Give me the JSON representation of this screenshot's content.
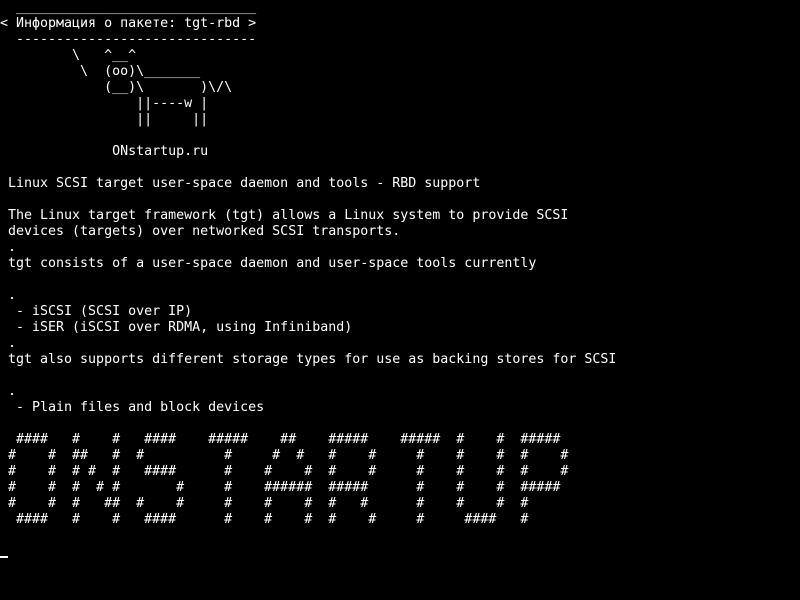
{
  "colors": {
    "background": "#000000",
    "foreground": "#ffffff"
  },
  "bubble": {
    "border_top": " ______________________________",
    "title": "< Информация о пакете: tgt-rbd >",
    "border_bottom": " ------------------------------"
  },
  "cow": [
    "        \\   ^__^",
    "         \\  (oo)\\_______",
    "            (__)\\       )\\/\\",
    "                ||----w |",
    "                ||     ||"
  ],
  "site": "             ONstartup.ru",
  "description": [
    "Linux SCSI target user-space daemon and tools - RBD support",
    "",
    "The Linux target framework (tgt) allows a Linux system to provide SCSI",
    "devices (targets) over networked SCSI transports.",
    ".",
    "tgt consists of a user-space daemon and user-space tools currently",
    "",
    ".",
    " - iSCSI (SCSI over IP)",
    " - iSER (iSCSI over RDMA, using Infiniband)",
    ".",
    "tgt also supports different storage types for use as backing stores for SCSI",
    "",
    ".",
    " - Plain files and block devices"
  ],
  "banner": [
    " ####   #    #   ####    #####    ##    #####    #####  #    #  #####",
    "#    #  ##   #  #          #     #  #   #    #     #    #    #  #    #",
    "#    #  # #  #   ####      #    #    #  #    #     #    #    #  #    #",
    "#    #  #  # #       #     #    ######  #####      #    #    #  #####",
    "#    #  #   ##  #    #     #    #    #  #   #      #    #    #  #",
    " ####   #    #   ####      #    #    #  #    #     #     ####   #"
  ]
}
